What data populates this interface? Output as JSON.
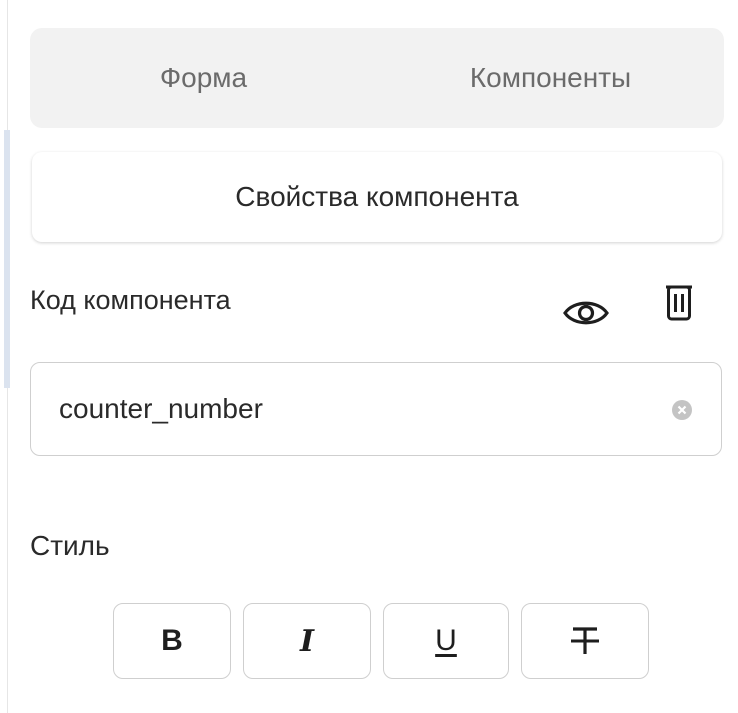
{
  "tabs": [
    {
      "label": "Форма"
    },
    {
      "label": "Компоненты"
    }
  ],
  "subtab": {
    "label": "Свойства компонента"
  },
  "component_code": {
    "label": "Код компонента",
    "value": "counter_number",
    "visibility_icon": "eye-icon",
    "delete_icon": "trash-icon",
    "clear_icon": "clear-circle-icon"
  },
  "style": {
    "label": "Стиль",
    "buttons": [
      {
        "label": "B",
        "name": "bold"
      },
      {
        "label": "I",
        "name": "italic"
      },
      {
        "label": "U",
        "name": "underline"
      },
      {
        "label": "T",
        "name": "strikethrough"
      }
    ]
  },
  "colors": {
    "tab_background": "#f2f2f2",
    "tab_text": "#6b6b6b",
    "border": "#cfcfcf",
    "accent_strip": "#dbe3ef"
  }
}
